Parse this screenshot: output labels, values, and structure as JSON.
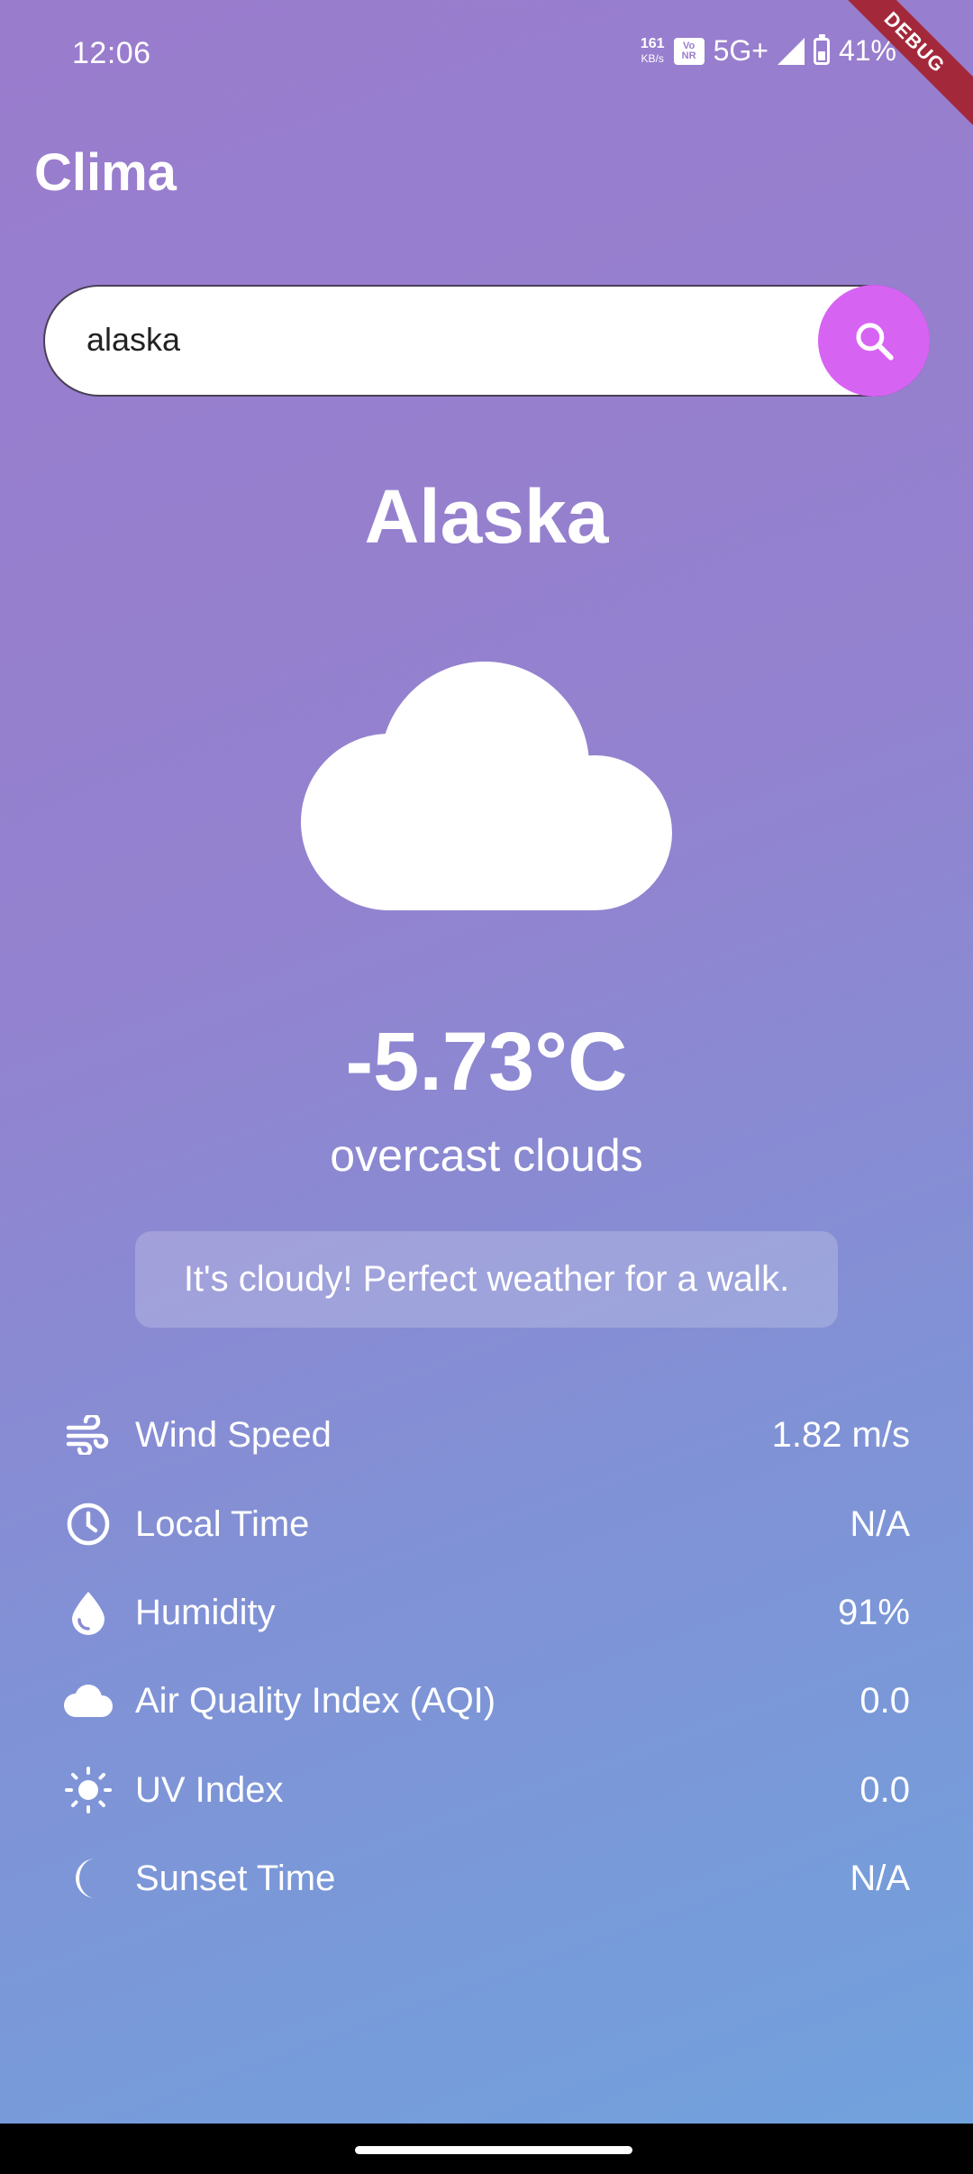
{
  "status_bar": {
    "time": "12:06",
    "net_speed_value": "161",
    "net_speed_unit": "KB/s",
    "vonr_line1": "Vo",
    "vonr_line2": "NR",
    "network": "5G+",
    "battery": "41%",
    "debug_label": "DEBUG"
  },
  "app": {
    "title": "Clima"
  },
  "search": {
    "value": "alaska",
    "icon": "search-icon"
  },
  "weather": {
    "city": "Alaska",
    "icon": "cloud-icon",
    "temperature": "-5.73°C",
    "description": "overcast clouds",
    "advice": "It's cloudy! Perfect weather for a walk."
  },
  "details": [
    {
      "icon": "wind-icon",
      "label": "Wind Speed",
      "value": "1.82 m/s"
    },
    {
      "icon": "clock-icon",
      "label": "Local Time",
      "value": "N/A"
    },
    {
      "icon": "water-drop-icon",
      "label": "Humidity",
      "value": "91%"
    },
    {
      "icon": "cloud-icon",
      "label": "Air Quality Index (AQI)",
      "value": "0.0"
    },
    {
      "icon": "sun-icon",
      "label": "UV Index",
      "value": "0.0"
    },
    {
      "icon": "moon-icon",
      "label": "Sunset Time",
      "value": "N/A"
    }
  ],
  "colors": {
    "search_button": "#d763f3",
    "debug_banner": "#a3283a",
    "gradient_top": "#9a7ccd",
    "gradient_bottom": "#70a3dd"
  }
}
